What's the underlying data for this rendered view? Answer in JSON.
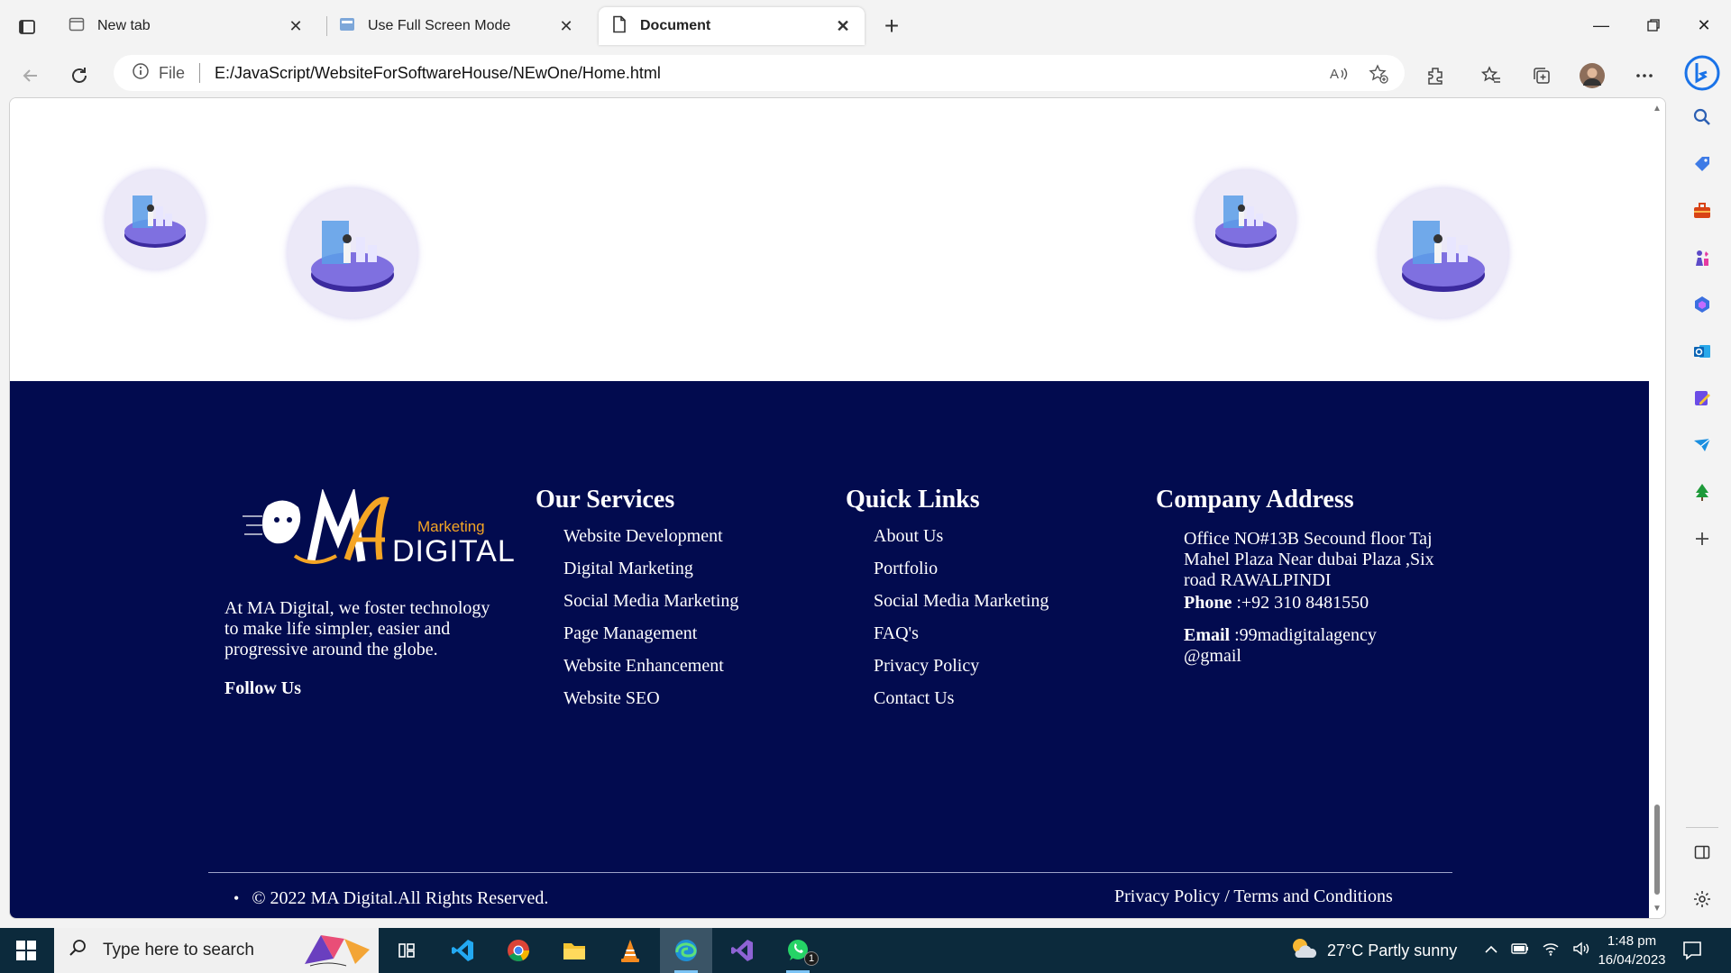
{
  "browser": {
    "tabs": [
      {
        "label": "New tab",
        "active": false
      },
      {
        "label": "Use Full Screen Mode",
        "active": false
      },
      {
        "label": "Document",
        "active": true
      }
    ],
    "address": {
      "scheme_label": "File",
      "url": "E:/JavaScript/WebsiteForSoftwareHouse/NEwOne/Home.html"
    }
  },
  "footer": {
    "logo": {
      "word_marketing": "Marketing",
      "word_digital": "DIGITAL"
    },
    "about_text": "At MA Digital, we foster technology to make life simpler, easier and progressive around the globe.",
    "follow_us": "Follow Us",
    "services": {
      "heading": "Our Services",
      "items": [
        "Website Development",
        "Digital Marketing",
        "Social Media Marketing",
        "Page Management",
        "Website Enhancement",
        "Website SEO"
      ]
    },
    "quick_links": {
      "heading": "Quick Links",
      "items": [
        "About Us",
        "Portfolio",
        "Social Media Marketing",
        "FAQ's",
        "Privacy Policy",
        "Contact Us"
      ]
    },
    "company": {
      "heading": "Company Address",
      "address": "Office NO#13B Secound floor Taj Mahel Plaza Near dubai Plaza ,Six road RAWALPINDI",
      "phone_label": "Phone",
      "phone_value": ":+92 310 8481550",
      "email_label": "Email",
      "email_value": ":99madigitalagency @gmail"
    },
    "copyright": "© 2022 MA Digital.All Rights Reserved.",
    "legal": "Privacy Policy / Terms and Conditions"
  },
  "taskbar": {
    "search_placeholder": "Type here to search",
    "weather": "27°C  Partly sunny",
    "time": "1:48 pm",
    "date": "16/04/2023",
    "whatsapp_badge": "1"
  },
  "colors": {
    "footer_bg": "#020b4f",
    "logo_gold": "#f5a524",
    "taskbar_bg": "#0c2a3c"
  }
}
